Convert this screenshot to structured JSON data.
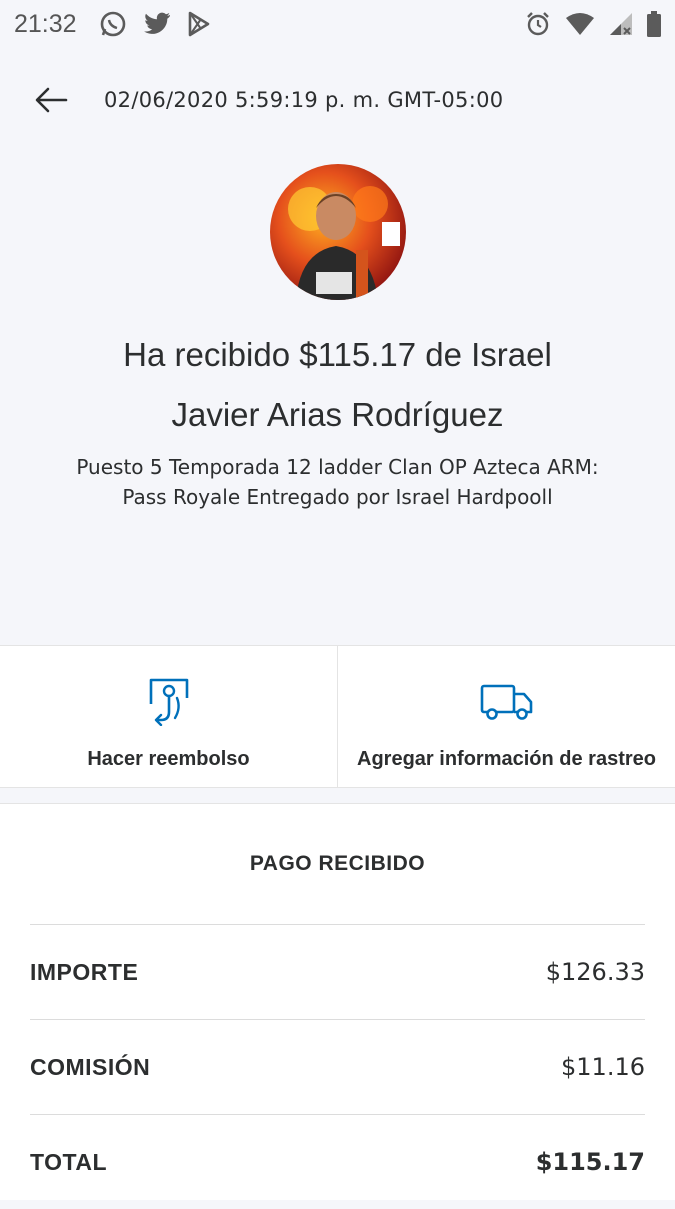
{
  "status_bar": {
    "time": "21:32",
    "left_icons": [
      "whatsapp-icon",
      "twitter-icon",
      "play-store-icon"
    ],
    "right_icons": [
      "alarm-icon",
      "wifi-icon",
      "signal-icon",
      "battery-icon"
    ]
  },
  "header": {
    "back_icon": "arrow-left-icon",
    "datetime": "02/06/2020 5:59:19 p. m. GMT-05:00"
  },
  "transaction": {
    "headline_line1": "Ha recibido $115.17 de Israel",
    "headline_line2": "Javier Arias Rodríguez",
    "note_line1": "Puesto 5 Temporada 12 ladder Clan OP Azteca ARM:",
    "note_line2": "Pass Royale Entregado por Israel Hardpooll"
  },
  "actions": [
    {
      "label": "Hacer reembolso",
      "icon": "refund-icon"
    },
    {
      "label": "Agregar información de rastreo",
      "icon": "truck-icon"
    }
  ],
  "details": {
    "section_title": "PAGO RECIBIDO",
    "rows": [
      {
        "label": "IMPORTE",
        "value": "$126.33"
      },
      {
        "label": "COMISIÓN",
        "value": "$11.16"
      },
      {
        "label": "TOTAL",
        "value": "$115.17"
      }
    ]
  },
  "colors": {
    "accent": "#0070ba",
    "background": "#f5f6fa",
    "text": "#2c2e2f"
  }
}
